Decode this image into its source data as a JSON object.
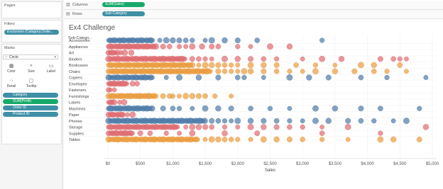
{
  "left_panel": {
    "pages_title": "Pages",
    "filters_title": "Filters",
    "filter_pill": "Exclusions (Category,Order... ",
    "marks_title": "Marks",
    "mark_type": "Circle",
    "mark_buttons": [
      "Color",
      "Size",
      "Label",
      "Detail",
      "Tooltip"
    ],
    "mark_fields": [
      "Category",
      "SUM(Profit)",
      "Order ID",
      "Product ID"
    ]
  },
  "shelves": {
    "columns_label": "Columns",
    "columns_pill": "SUM(Sales)",
    "rows_label": "Rows",
    "rows_pill": "Sub-Category"
  },
  "chart_data": {
    "type": "scatter",
    "title": "Ex4 Challenge",
    "row_header": "Sub-Catego...",
    "xlabel": "Sales",
    "xlim": [
      0,
      5000
    ],
    "x_ticks": [
      "$0",
      "$500",
      "$1,000",
      "$1,500",
      "$2,000",
      "$2,500",
      "$3,000",
      "$3,500",
      "$4,000",
      "$4,500",
      "$5,000"
    ],
    "category_colors": {
      "Office Supplies": "#de6b70",
      "Furniture": "#ea9b3e",
      "Technology": "#4e7ba7"
    },
    "categories": [
      {
        "name": "Accessories",
        "group": "Technology",
        "dense_max": 700,
        "sparse": [
          800,
          900,
          1000,
          1100,
          1200,
          1300,
          1500,
          1600,
          1800,
          2000,
          2300,
          3300
        ]
      },
      {
        "name": "Appliances",
        "group": "Office Supplies",
        "dense_max": 750,
        "sparse": [
          850,
          950,
          1100,
          1200,
          1300,
          1450,
          1600,
          1700,
          2000,
          2200,
          2500,
          2800
        ]
      },
      {
        "name": "Art",
        "group": "Office Supplies",
        "dense_max": 150,
        "sparse": [
          200,
          260,
          360
        ]
      },
      {
        "name": "Binders",
        "group": "Office Supplies",
        "dense_max": 1200,
        "sparse": [
          1300,
          1400,
          1500,
          1600,
          1800,
          2000,
          2200,
          2400,
          2600,
          3000,
          3300,
          3600,
          4200,
          4400,
          4500,
          4600
        ]
      },
      {
        "name": "Bookcases",
        "group": "Furniture",
        "dense_max": 1300,
        "sparse": [
          1400,
          1500,
          1600,
          1700,
          1800,
          1900,
          2000,
          2200,
          2400,
          2600,
          2900,
          3200,
          3500,
          3900,
          4100,
          4500
        ]
      },
      {
        "name": "Chairs",
        "group": "Furniture",
        "dense_max": 1600,
        "sparse": [
          1700,
          1800,
          1900,
          2000,
          2100,
          2200,
          2400,
          2600,
          2800,
          3000,
          3200,
          3500,
          3800,
          4100,
          4300,
          4600
        ]
      },
      {
        "name": "Copiers",
        "group": "Technology",
        "dense_max": 700,
        "sparse": [
          900,
          1100,
          1400,
          1700,
          2000,
          2100,
          2400,
          2800,
          3100,
          3400,
          3900,
          4300,
          4900
        ]
      },
      {
        "name": "Envelopes",
        "group": "Office Supplies",
        "dense_max": 300,
        "sparse": [
          380,
          450
        ]
      },
      {
        "name": "Fasteners",
        "group": "Office Supplies",
        "dense_max": 60,
        "sparse": [
          100
        ]
      },
      {
        "name": "Furnishings",
        "group": "Furniture",
        "dense_max": 750,
        "sparse": [
          850,
          950,
          1000,
          1100,
          1200,
          1300,
          1400,
          1500,
          1650,
          1900
        ]
      },
      {
        "name": "Labels",
        "group": "Office Supplies",
        "dense_max": 120,
        "sparse": [
          180,
          250
        ]
      },
      {
        "name": "Machines",
        "group": "Technology",
        "dense_max": 700,
        "sparse": [
          850,
          1000,
          1100,
          1300,
          1500,
          1700,
          1900,
          2200,
          2500,
          2800,
          3200,
          3500,
          3900,
          4200,
          4800
        ]
      },
      {
        "name": "Paper",
        "group": "Office Supplies",
        "dense_max": 250,
        "sparse": [
          300,
          380
        ]
      },
      {
        "name": "Phones",
        "group": "Technology",
        "dense_max": 1500,
        "sparse": [
          1600,
          1700,
          1800,
          1900,
          2000,
          2200,
          2400,
          2600,
          2800,
          3000,
          3200,
          3400,
          3700,
          3900,
          4100,
          4400,
          4600
        ]
      },
      {
        "name": "Storage",
        "group": "Office Supplies",
        "dense_max": 1100,
        "sparse": [
          1200,
          1300,
          1400,
          1500,
          1600,
          1800,
          2000,
          2200,
          2400,
          2600,
          2800,
          3000,
          3300,
          3700,
          4900
        ]
      },
      {
        "name": "Supplies",
        "group": "Office Supplies",
        "dense_max": 400,
        "sparse": [
          500,
          650,
          900,
          1100,
          1300,
          1800,
          2300,
          3300,
          4200
        ]
      },
      {
        "name": "Tables",
        "group": "Furniture",
        "dense_max": 1400,
        "sparse": [
          1500,
          1600,
          1700,
          1800,
          1900,
          2000,
          2200,
          2400,
          2600,
          2800,
          3000,
          3300,
          3700,
          4200,
          4400,
          4800
        ]
      }
    ]
  }
}
